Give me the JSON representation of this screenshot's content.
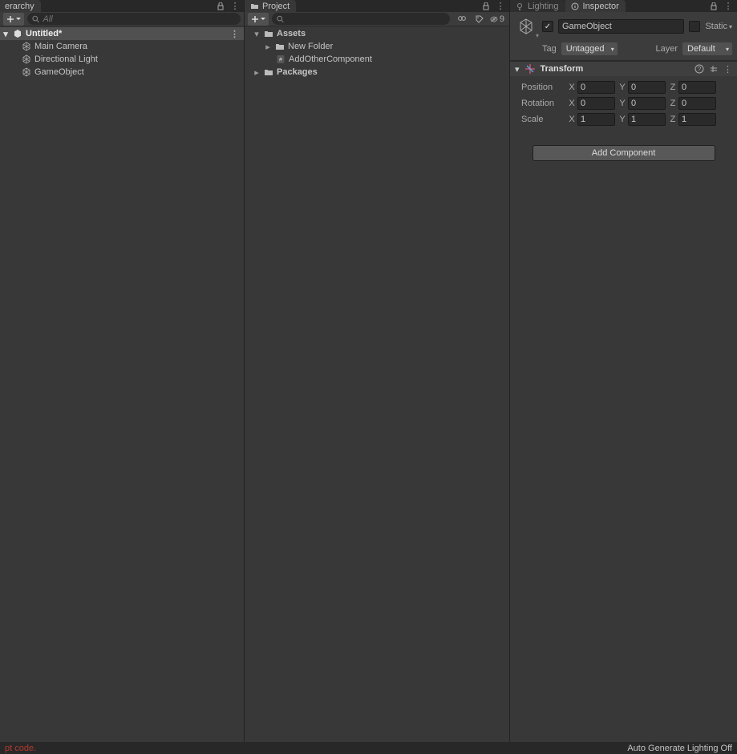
{
  "hierarchy": {
    "tab_label": "erarchy",
    "search_placeholder": "All",
    "scene": "Untitled*",
    "items": [
      "Main Camera",
      "Directional Light",
      "GameObject"
    ]
  },
  "project": {
    "tab_label": "Project",
    "search_placeholder": "",
    "hidden_count": "9",
    "root": "Assets",
    "root_children": [
      {
        "name": "New Folder",
        "icon": "folder"
      },
      {
        "name": "AddOtherComponent",
        "icon": "script"
      }
    ],
    "packages": "Packages"
  },
  "inspector": {
    "lighting_tab": "Lighting",
    "inspector_tab": "Inspector",
    "name": "GameObject",
    "static_label": "Static",
    "tag_label": "Tag",
    "tag_value": "Untagged",
    "layer_label": "Layer",
    "layer_value": "Default",
    "transform": {
      "title": "Transform",
      "position": {
        "label": "Position",
        "x": "0",
        "y": "0",
        "z": "0"
      },
      "rotation": {
        "label": "Rotation",
        "x": "0",
        "y": "0",
        "z": "0"
      },
      "scale": {
        "label": "Scale",
        "x": "1",
        "y": "1",
        "z": "1"
      }
    },
    "add_component": "Add Component"
  },
  "statusbar": {
    "error": "pt code.",
    "lighting": "Auto Generate Lighting Off"
  }
}
